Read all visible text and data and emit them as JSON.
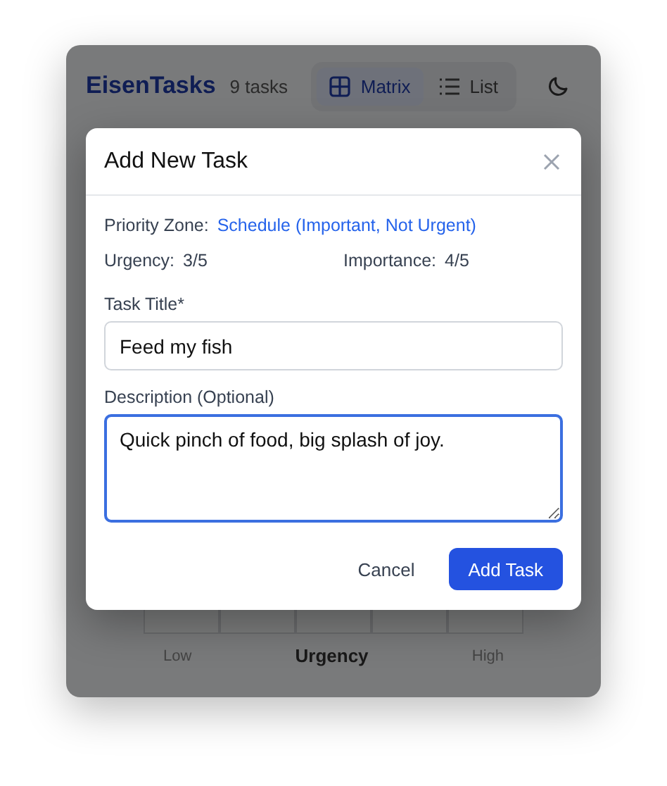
{
  "app": {
    "title": "EisenTasks",
    "task_count": "9 tasks",
    "views": [
      {
        "label": "Matrix",
        "selected": true
      },
      {
        "label": "List",
        "selected": false
      }
    ],
    "axis": {
      "low": "Low",
      "label": "Urgency",
      "high": "High"
    }
  },
  "modal": {
    "title": "Add New Task",
    "priority_zone": {
      "label": "Priority Zone:",
      "value": "Schedule (Important, Not Urgent)"
    },
    "urgency": {
      "label": "Urgency:",
      "value": "3/5"
    },
    "importance": {
      "label": "Importance:",
      "value": "4/5"
    },
    "title_field": {
      "label": "Task Title*",
      "value": "Feed my fish"
    },
    "description_field": {
      "label": "Description (Optional)",
      "value": "Quick pinch of food, big splash of joy.",
      "focused": true
    },
    "buttons": [
      {
        "label": "Cancel",
        "kind": "secondary"
      },
      {
        "label": "Add Task",
        "kind": "primary"
      }
    ]
  }
}
